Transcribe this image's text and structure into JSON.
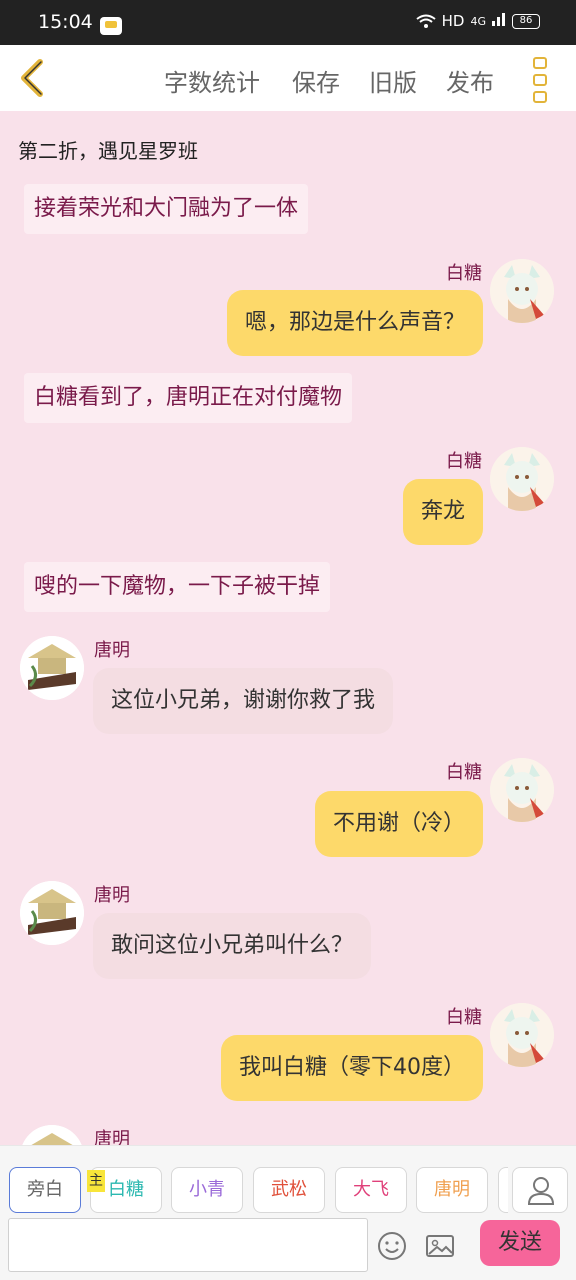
{
  "status_bar": {
    "time": "15:04",
    "network": "HD",
    "signal": "4G",
    "battery": "86"
  },
  "header": {
    "word_count": "字数统计",
    "save": "保存",
    "old_version": "旧版",
    "publish": "发布"
  },
  "chat": {
    "chapter_title": "第二折，遇见星罗班",
    "narration_1": "接着荣光和大门融为了一体",
    "msg_1_name": "白糖",
    "msg_1_text": "嗯，那边是什么声音？",
    "narration_2": "白糖看到了，唐明正在对付魔物",
    "msg_2_name": "白糖",
    "msg_2_text": "奔龙",
    "narration_3": "嗖的一下魔物，一下子被干掉",
    "msg_3_name": "唐明",
    "msg_3_text": "这位小兄弟，谢谢你救了我",
    "msg_4_name": "白糖",
    "msg_4_text": "不用谢（冷）",
    "msg_5_name": "唐明",
    "msg_5_text": "敢问这位小兄弟叫什么？",
    "msg_6_name": "白糖",
    "msg_6_text": "我叫白糖（零下40度）",
    "msg_7_name": "唐明"
  },
  "toolbar": {
    "roles": [
      {
        "label": "旁白",
        "color": "#666666"
      },
      {
        "label": "白糖",
        "color": "#2bb8b0"
      },
      {
        "label": "小青",
        "color": "#9a6ad8"
      },
      {
        "label": "武松",
        "color": "#e0503a"
      },
      {
        "label": "大飞",
        "color": "#e0407a"
      },
      {
        "label": "唐明",
        "color": "#f0a050"
      }
    ],
    "main_tag": "主",
    "send": "发送"
  }
}
